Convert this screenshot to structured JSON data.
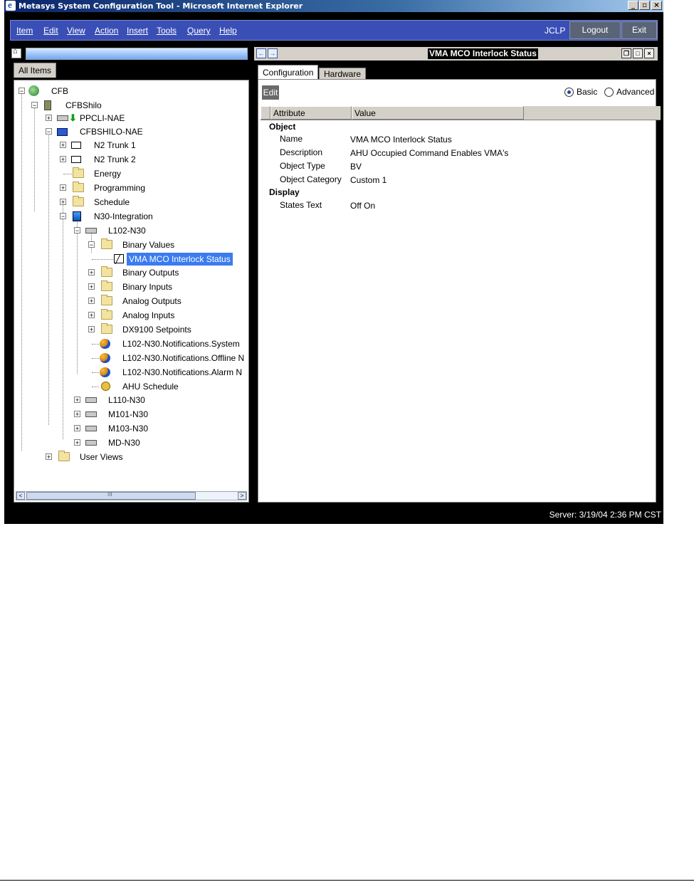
{
  "window": {
    "title": "Metasys System Configuration Tool - Microsoft Internet Explorer",
    "controls": [
      "_",
      "▫",
      "×"
    ]
  },
  "menubar": {
    "items": [
      "Item",
      "Edit",
      "View",
      "Action",
      "Insert",
      "Tools",
      "Query",
      "Help"
    ],
    "user": "JCLP",
    "logout": "Logout",
    "exit": "Exit"
  },
  "left": {
    "tab": "All Items",
    "tree": [
      {
        "label": "CFB",
        "icon": "globe-icon"
      },
      {
        "label": "CFBShilo",
        "icon": "building-icon"
      },
      {
        "label": "PPCLI-NAE",
        "icon": "device-icon"
      },
      {
        "label": "CFBSHILO-NAE",
        "icon": "nae-icon"
      },
      {
        "label": "N2 Trunk 1",
        "icon": "trunk-icon"
      },
      {
        "label": "N2 Trunk 2",
        "icon": "trunk-icon"
      },
      {
        "label": "Energy",
        "icon": "folder-icon"
      },
      {
        "label": "Programming",
        "icon": "folder-icon"
      },
      {
        "label": "Schedule",
        "icon": "folder-icon"
      },
      {
        "label": "N30-Integration",
        "icon": "integration-icon"
      },
      {
        "label": "L102-N30",
        "icon": "device-icon"
      },
      {
        "label": "Binary Values",
        "icon": "folder-icon"
      },
      {
        "label": "VMA MCO Interlock Status",
        "icon": "binary-value-icon",
        "selected": true
      },
      {
        "label": "Binary Outputs",
        "icon": "folder-icon"
      },
      {
        "label": "Binary Inputs",
        "icon": "folder-icon"
      },
      {
        "label": "Analog Outputs",
        "icon": "folder-icon"
      },
      {
        "label": "Analog Inputs",
        "icon": "folder-icon"
      },
      {
        "label": "DX9100 Setpoints",
        "icon": "folder-icon"
      },
      {
        "label": "L102-N30.Notifications.System",
        "icon": "notification-icon"
      },
      {
        "label": "L102-N30.Notifications.Offline N",
        "icon": "notification-icon"
      },
      {
        "label": "L102-N30.Notifications.Alarm N",
        "icon": "notification-icon"
      },
      {
        "label": "AHU Schedule",
        "icon": "schedule-icon"
      },
      {
        "label": "L110-N30",
        "icon": "device-icon"
      },
      {
        "label": "M101-N30",
        "icon": "device-icon"
      },
      {
        "label": "M103-N30",
        "icon": "device-icon"
      },
      {
        "label": "MD-N30",
        "icon": "device-icon"
      },
      {
        "label": "User Views",
        "icon": "folder-icon"
      }
    ],
    "scroll_arrows": {
      "left": "<",
      "right": ">",
      "thumb": "III"
    }
  },
  "right": {
    "title": "VMA MCO Interlock Status",
    "tabs": [
      "Configuration",
      "Hardware"
    ],
    "edit": "Edit",
    "mode_basic": "Basic",
    "mode_advanced": "Advanced",
    "mode_selected": "Basic",
    "columns": [
      "Attribute",
      "Value"
    ],
    "groups": [
      {
        "name": "Object",
        "rows": [
          {
            "attr": "Name",
            "value": "VMA MCO Interlock Status"
          },
          {
            "attr": "Description",
            "value": "AHU Occupied Command Enables VMA's"
          },
          {
            "attr": "Object Type",
            "value": "BV"
          },
          {
            "attr": "Object Category",
            "value": "Custom 1"
          }
        ]
      },
      {
        "name": "Display",
        "rows": [
          {
            "attr": "States Text",
            "value": "Off On"
          }
        ]
      }
    ],
    "nav_back": "←",
    "nav_fwd": "→"
  },
  "status": {
    "server": "Server: 3/19/04 2:36 PM CST"
  }
}
